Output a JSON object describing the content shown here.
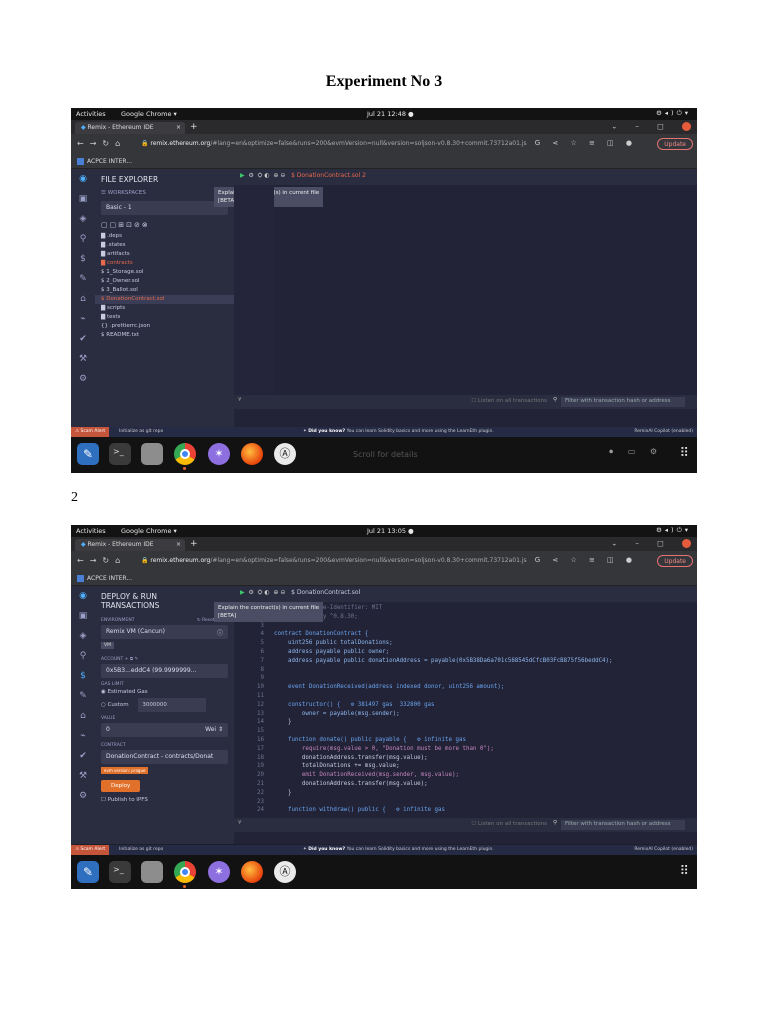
{
  "document": {
    "title": "Experiment No 3",
    "page_number": "2"
  },
  "screens": [
    {
      "topbar": {
        "activities": "Activities",
        "app": "Google Chrome ▾",
        "clock": "Jul 21  12:48  ●"
      },
      "tab": {
        "title": "Remix - Ethereum IDE",
        "close": "×",
        "new": "+"
      },
      "url": {
        "domain": "remix.ethereum.org",
        "rest": "/#lang=en&optimize=false&runs=200&evmVersion=null&version=soljson-v0.8.30+commit.73712a01.js"
      },
      "update_label": "Update",
      "bookmark": "ACPCE INTER...",
      "panel_title": "FILE EXPLORER",
      "workspaces_label": "WORKSPACES",
      "workspace": "Basic - 1",
      "tooltip": [
        "Explain the contract(s) in current file",
        "[BETA]"
      ],
      "editor_file": "DonationContract.sol 2",
      "files": [
        {
          "name": ".deps",
          "kind": "folder"
        },
        {
          "name": ".states",
          "kind": "folder"
        },
        {
          "name": "artifacts",
          "kind": "folder"
        },
        {
          "name": "contracts",
          "kind": "folder-open"
        },
        {
          "name": "1_Storage.sol",
          "kind": "file"
        },
        {
          "name": "2_Owner.sol",
          "kind": "file"
        },
        {
          "name": "3_Ballot.sol",
          "kind": "file"
        },
        {
          "name": "DonationContract.sol",
          "kind": "selected"
        },
        {
          "name": "scripts",
          "kind": "folder"
        },
        {
          "name": "tests",
          "kind": "folder"
        },
        {
          "name": ".prettierrc.json",
          "kind": "json"
        },
        {
          "name": "README.txt",
          "kind": "file"
        }
      ],
      "terminal": {
        "listen": "Listen on all transactions",
        "filter": "Filter with transaction hash or address"
      },
      "status": {
        "alert": "Scam Alert",
        "init": "Initialize as git repo",
        "know_bold": "Did you know?",
        "know": "You can learn Solidity basics and more using the LearnEth plugin.",
        "copilot": "RemixAI Copilot (enabled)"
      },
      "dock": {
        "scroll_hint": "Scroll for details"
      }
    },
    {
      "topbar": {
        "activities": "Activities",
        "app": "Google Chrome ▾",
        "clock": "Jul 21  13:05  ●"
      },
      "tab": {
        "title": "Remix - Ethereum IDE",
        "close": "×",
        "new": "+"
      },
      "url": {
        "domain": "remix.ethereum.org",
        "rest": "/#lang=en&optimize=false&runs=200&evmVersion=null&version=soljson-v0.8.30+commit.73712a01.js"
      },
      "update_label": "Update",
      "bookmark": "ACPCE INTER...",
      "panel_title_1": "DEPLOY & RUN",
      "panel_title_2": "TRANSACTIONS",
      "tooltip": [
        "Explain the contract(s) in current file",
        "[BETA]"
      ],
      "editor_file": "DonationContract.sol",
      "environment_label": "ENVIRONMENT",
      "reset_label": "Reset State",
      "environment": "Remix VM (Cancun)",
      "vm_badge": "VM",
      "account_label": "ACCOUNT",
      "account": "0x5B3...eddC4 (99.9999999...",
      "gas_label": "GAS LIMIT",
      "gas_estimated": "Estimated Gas",
      "gas_custom": "Custom",
      "gas_value": "3000000",
      "value_label": "VALUE",
      "value": "0",
      "value_unit": "Wei",
      "contract_label": "CONTRACT",
      "contract": "DonationContract - contracts/Donat",
      "evm_badge": "evm version: prague",
      "deploy": "Deploy",
      "publish": "Publish to IPFS",
      "code_lines": [
        {
          "n": "1",
          "t": "// SPDX-License-Identifier: MIT"
        },
        {
          "n": "2",
          "t": "pragma solidity ^0.8.30;"
        },
        {
          "n": "3",
          "t": ""
        },
        {
          "n": "4",
          "t": "contract DonationContract {"
        },
        {
          "n": "5",
          "t": "    uint256 public totalDonations;"
        },
        {
          "n": "6",
          "t": "    address payable public owner;"
        },
        {
          "n": "7",
          "t": "    address payable public donationAddress = payable(0x5B38Da6a701c568545dCfcB03FcB875f56beddC4);"
        },
        {
          "n": "8",
          "t": ""
        },
        {
          "n": "9",
          "t": ""
        },
        {
          "n": "10",
          "t": "    event DonationReceived(address indexed donor, uint256 amount);"
        },
        {
          "n": "11",
          "t": ""
        },
        {
          "n": "12",
          "t": "    constructor() {   ⚙ 381497 gas  332800 gas"
        },
        {
          "n": "13",
          "t": "        owner = payable(msg.sender);"
        },
        {
          "n": "14",
          "t": "    }"
        },
        {
          "n": "15",
          "t": ""
        },
        {
          "n": "16",
          "t": "    function donate() public payable {   ⚙ infinite gas"
        },
        {
          "n": "17",
          "t": "        require(msg.value > 0, \"Donation must be more than 0\");"
        },
        {
          "n": "18",
          "t": "        donationAddress.transfer(msg.value);"
        },
        {
          "n": "19",
          "t": "        totalDonations += msg.value;"
        },
        {
          "n": "20",
          "t": "        emit DonationReceived(msg.sender, msg.value);"
        },
        {
          "n": "21",
          "t": "        donationAddress.transfer(msg.value);"
        },
        {
          "n": "22",
          "t": "    }"
        },
        {
          "n": "23",
          "t": ""
        },
        {
          "n": "24",
          "t": "    function withdraw() public {   ⚙ infinite gas"
        }
      ],
      "terminal": {
        "listen": "Listen on all transactions",
        "filter": "Filter with transaction hash or address"
      },
      "status": {
        "alert": "Scam Alert",
        "init": "Initialize as git repo",
        "know_bold": "Did you know?",
        "know": "You can learn Solidity basics and more using the LearnEth plugin.",
        "copilot": "RemixAI Copilot (enabled)"
      }
    }
  ]
}
